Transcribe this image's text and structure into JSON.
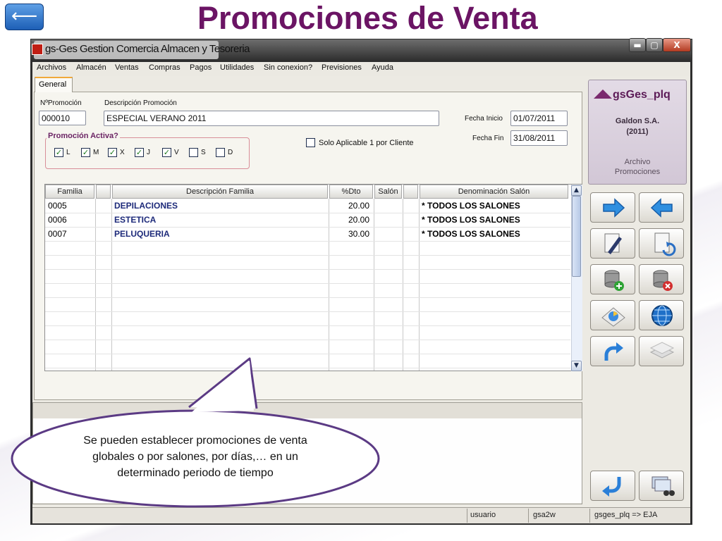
{
  "slide": {
    "title": "Promociones de Venta",
    "back_glyph": "⟵",
    "callout_text": "Se pueden establecer promociones de venta globales o por salones, por días,… en un determinado periodo de tiempo"
  },
  "window": {
    "title": "gs-Ges Gestion Comercia Almacen y Tesoreria",
    "close_glyph": "X",
    "min_glyph": "▬",
    "max_glyph": "▢"
  },
  "menu": [
    "Archivos",
    "Almacén",
    "Ventas",
    "Compras",
    "Pagos",
    "Utilidades",
    "Sin conexion?",
    "Previsiones",
    "Ayuda"
  ],
  "tabs": [
    "General"
  ],
  "form": {
    "num_label": "NºPromoción",
    "num_value": "000010",
    "desc_label": "Descripción Promoción",
    "desc_value": "ESPECIAL VERANO 2011",
    "fecha_inicio_label": "Fecha Inicio",
    "fecha_inicio_value": "01/07/2011",
    "fecha_fin_label": "Fecha Fin",
    "fecha_fin_value": "31/08/2011",
    "group_title": "Promoción Activa?",
    "days": [
      {
        "label": "L",
        "checked": true
      },
      {
        "label": "M",
        "checked": true
      },
      {
        "label": "X",
        "checked": true
      },
      {
        "label": "J",
        "checked": true
      },
      {
        "label": "V",
        "checked": true
      },
      {
        "label": "S",
        "checked": false
      },
      {
        "label": "D",
        "checked": false
      }
    ],
    "solo_label": "Solo Aplicable 1 por Cliente",
    "solo_checked": false
  },
  "grid": {
    "headers": [
      "Familia",
      "",
      "Descripción Familia",
      "%Dto",
      "Salón",
      "",
      "Denominación Salón"
    ],
    "rows": [
      {
        "familia": "0005",
        "descripcion": "DEPILACIONES",
        "dto": "20.00",
        "salon": "",
        "denominacion": "* TODOS LOS SALONES"
      },
      {
        "familia": "0006",
        "descripcion": "ESTETICA",
        "dto": "20.00",
        "salon": "",
        "denominacion": "* TODOS LOS SALONES"
      },
      {
        "familia": "0007",
        "descripcion": "PELUQUERIA",
        "dto": "30.00",
        "salon": "",
        "denominacion": "* TODOS LOS SALONES"
      }
    ],
    "scroll_up_glyph": "▲",
    "scroll_down_glyph": "▼"
  },
  "brand": {
    "name": "gsGes_plq",
    "company": "Galdon S.A.",
    "year": "(2011)",
    "section_line1": "Archivo",
    "section_line2": "Promociones"
  },
  "toolbar_icons": [
    "arrow-right-icon",
    "arrow-left-icon",
    "edit-document-icon",
    "export-document-icon",
    "add-database-icon",
    "delete-database-icon",
    "chart-icon",
    "globe-icon",
    "redo-icon",
    "layers-icon",
    "return-icon",
    "find-binoculars-icon"
  ],
  "statusbar": {
    "user": "usuario",
    "host": "gsa2w",
    "db": "gsges_plq => EJA"
  },
  "colors": {
    "title": "#6b1464",
    "accent_purple": "#7a2a6e",
    "callout_border": "#5b3a84"
  }
}
